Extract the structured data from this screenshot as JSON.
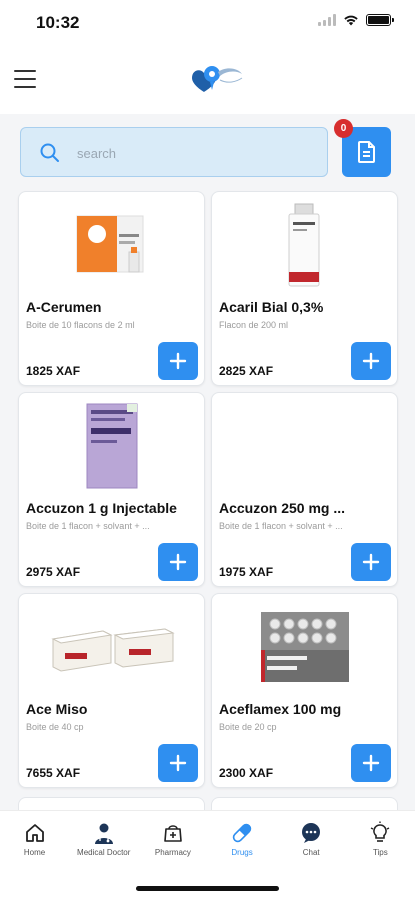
{
  "status": {
    "time": "10:32"
  },
  "search": {
    "placeholder": "search",
    "value": ""
  },
  "cart": {
    "badge": "0"
  },
  "colors": {
    "accent": "#2f8ff0",
    "badge": "#d72e2e",
    "search_bg": "#d9ebf8"
  },
  "products": [
    {
      "name": "A-Cerumen",
      "pack": "Boite de 10 flacons de 2 ml",
      "price": "1825 XAF",
      "image": "acerumen-box"
    },
    {
      "name": "Acaril Bial 0,3%",
      "pack": "Flacon de 200 ml",
      "price": "2825 XAF",
      "image": "acaril-bottle"
    },
    {
      "name": "Accuzon 1 g Injectable",
      "pack": "Boite de 1 flacon + solvant + ...",
      "price": "2975 XAF",
      "image": "accuzon-box"
    },
    {
      "name": "Accuzon 250 mg ...",
      "pack": "Boite de 1 flacon + solvant + ...",
      "price": "1975 XAF",
      "image": ""
    },
    {
      "name": "Ace Miso",
      "pack": "Boite de 40 cp",
      "price": "7655 XAF",
      "image": "acemiso-boxes"
    },
    {
      "name": "Aceflamex 100 mg",
      "pack": "Boite de 20 cp",
      "price": "2300 XAF",
      "image": "aceflamex-blister"
    }
  ],
  "nav": [
    {
      "label": "Home",
      "icon": "home-icon"
    },
    {
      "label": "Medical Doctor",
      "icon": "doctor-icon"
    },
    {
      "label": "Pharmacy",
      "icon": "pharmacy-icon"
    },
    {
      "label": "Drugs",
      "icon": "pill-icon",
      "active": true
    },
    {
      "label": "Chat",
      "icon": "chat-icon"
    },
    {
      "label": "Tips",
      "icon": "lightbulb-icon"
    }
  ]
}
